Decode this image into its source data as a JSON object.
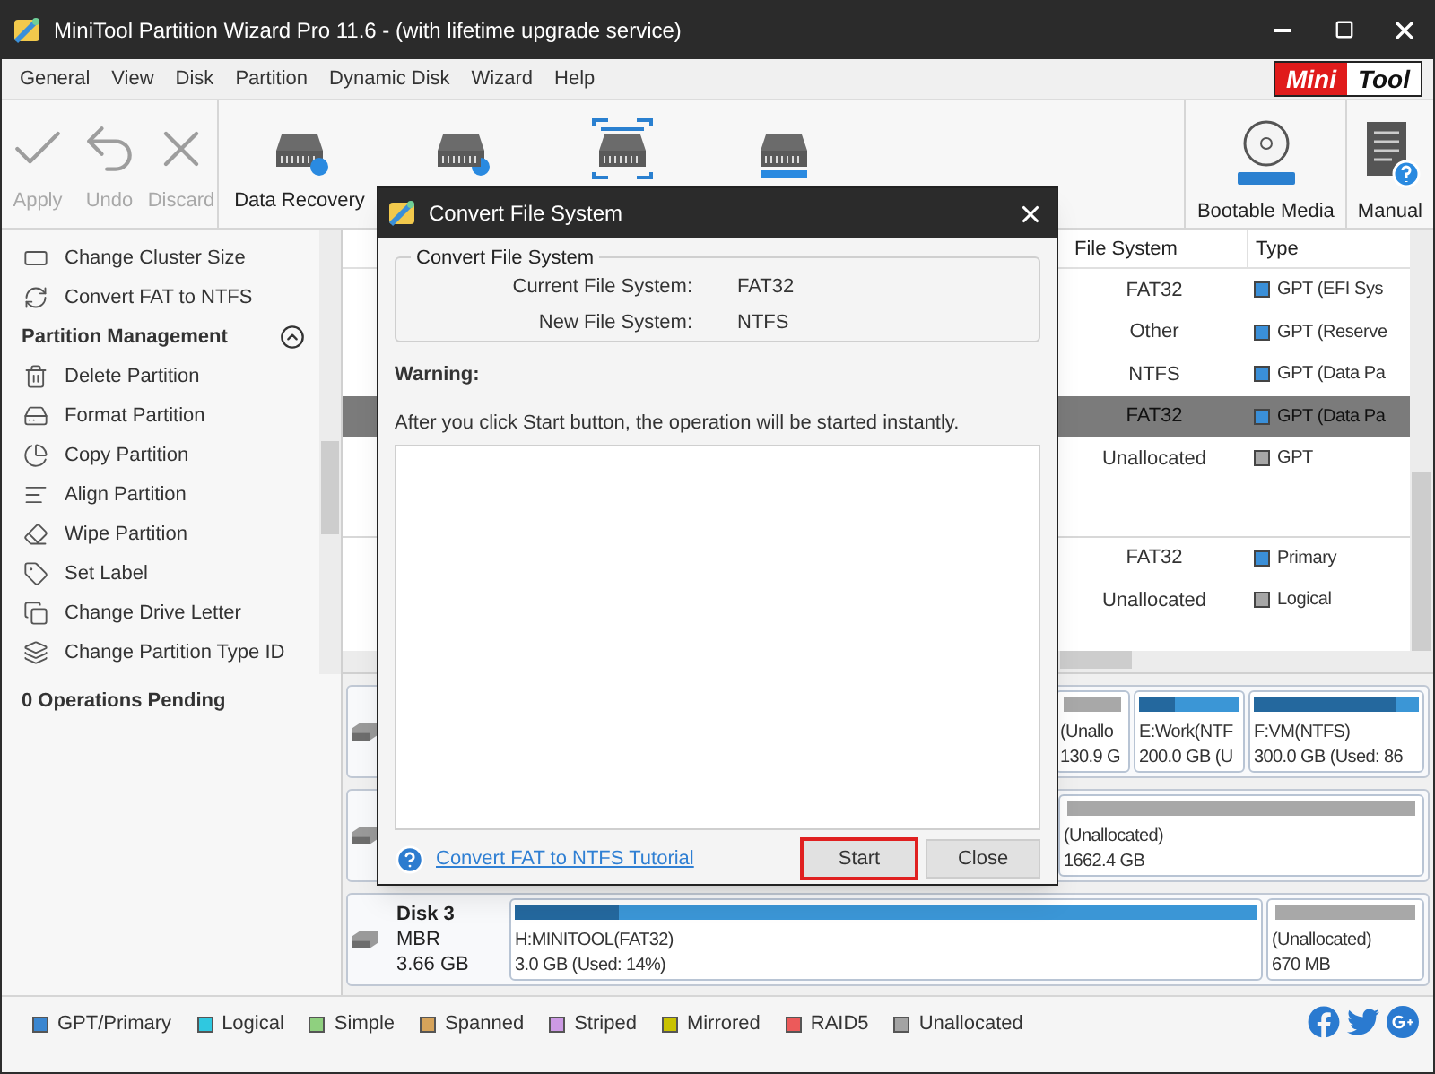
{
  "window": {
    "title": "MiniTool Partition Wizard Pro 11.6 - (with lifetime upgrade service)"
  },
  "menu": [
    "General",
    "View",
    "Disk",
    "Partition",
    "Dynamic Disk",
    "Wizard",
    "Help"
  ],
  "logo": {
    "part_1": "Mini",
    "part_2": "Tool"
  },
  "toolbar": [
    {
      "kind": "apply",
      "label": "Apply",
      "disabled": true
    },
    {
      "kind": "undo",
      "label": "Undo",
      "disabled": true
    },
    {
      "kind": "discard",
      "label": "Discard",
      "disabled": true
    },
    {
      "kind": "data-recovery",
      "label": "Data Recovery",
      "disabled": false
    },
    {
      "kind": "partition-recovery",
      "disabled": false
    },
    {
      "kind": "space-analyzer",
      "disabled": false
    },
    {
      "kind": "disk-benchmark",
      "disabled": false
    },
    {
      "kind": "bootable-media",
      "label": "Bootable Media",
      "disabled": false
    },
    {
      "kind": "manual",
      "label": "Manual",
      "disabled": false
    }
  ],
  "sidebar": {
    "items": [
      {
        "kind": "cluster",
        "label": "Change Cluster Size"
      },
      {
        "kind": "convert",
        "label": "Convert FAT to NTFS"
      }
    ],
    "section": {
      "title": "Partition Management",
      "expanded": true,
      "items": [
        {
          "kind": "delete",
          "label": "Delete Partition"
        },
        {
          "kind": "format",
          "label": "Format Partition"
        },
        {
          "kind": "copy",
          "label": "Copy Partition"
        },
        {
          "kind": "align",
          "label": "Align Partition"
        },
        {
          "kind": "wipe",
          "label": "Wipe Partition"
        },
        {
          "kind": "label",
          "label": "Set Label"
        },
        {
          "kind": "letter",
          "label": "Change Drive Letter"
        },
        {
          "kind": "type",
          "label": "Change Partition Type ID"
        }
      ]
    },
    "pending": "0 Operations Pending"
  },
  "table": {
    "columns": [
      "File System",
      "Type"
    ],
    "groups": [
      {
        "rows": [
          {
            "file_system": "FAT32",
            "type": "GPT (EFI Sys",
            "color": "#3a8fd8",
            "selected": false
          },
          {
            "file_system": "Other",
            "type": "GPT (Reserve",
            "color": "#3a8fd8",
            "selected": false
          },
          {
            "file_system": "NTFS",
            "type": "GPT (Data Pa",
            "color": "#3a8fd8",
            "selected": false
          },
          {
            "file_system": "FAT32",
            "type": "GPT (Data Pa",
            "color": "#3a8fd8",
            "selected": true
          },
          {
            "file_system": "Unallocated",
            "type": "GPT",
            "color": "#a6a6a6",
            "selected": false
          }
        ]
      },
      {
        "rows": [
          {
            "file_system": "FAT32",
            "type": "Primary",
            "color": "#3a8fd8",
            "selected": false
          },
          {
            "file_system": "Unallocated",
            "type": "Logical",
            "color": "#a6a6a6",
            "selected": false
          }
        ]
      }
    ]
  },
  "disks": [
    {
      "partitions": [
        {
          "name": "(Unallo",
          "size": "130.9 G",
          "kind": "unallocated"
        },
        {
          "name": "E:Work(NTF",
          "size": "200.0 GB (U",
          "kind": "used",
          "level": 0.35
        },
        {
          "name": "F:VM(NTFS)",
          "size": "300.0 GB (Used: 86",
          "kind": "used",
          "level": 0.86
        }
      ]
    },
    {
      "partitions": [
        {
          "name": "(Unallocated)",
          "size": "1662.4 GB",
          "kind": "unallocated"
        }
      ]
    },
    {
      "name": "Disk 3",
      "scheme": "MBR",
      "capacity": "3.66 GB",
      "partitions": [
        {
          "name": "H:MINITOOL(FAT32)",
          "size": "3.0 GB (Used: 14%)",
          "kind": "used",
          "level": 0.14
        },
        {
          "name": "(Unallocated)",
          "size": "670 MB",
          "kind": "unallocated"
        }
      ]
    }
  ],
  "legend": [
    {
      "label": "GPT/Primary",
      "color": "#3a86d0"
    },
    {
      "label": "Logical",
      "color": "#2fc8e0"
    },
    {
      "label": "Simple",
      "color": "#8fd07f"
    },
    {
      "label": "Spanned",
      "color": "#d6a35a"
    },
    {
      "label": "Striped",
      "color": "#cc9ae4"
    },
    {
      "label": "Mirrored",
      "color": "#c9c200"
    },
    {
      "label": "RAID5",
      "color": "#ec5a5a"
    },
    {
      "label": "Unallocated",
      "color": "#a3a3a3"
    }
  ],
  "dialog": {
    "title": "Convert File System",
    "group_title": "Convert File System",
    "fields": [
      {
        "label": "Current File System:",
        "value": "FAT32"
      },
      {
        "label": "New File System:",
        "value": "NTFS"
      }
    ],
    "warning_title": "Warning:",
    "message": "After you click Start button, the operation will be started instantly.",
    "link": "Convert FAT to NTFS Tutorial",
    "buttons": [
      {
        "label": "Start",
        "focused": true
      },
      {
        "label": "Close",
        "focused": false
      }
    ]
  }
}
